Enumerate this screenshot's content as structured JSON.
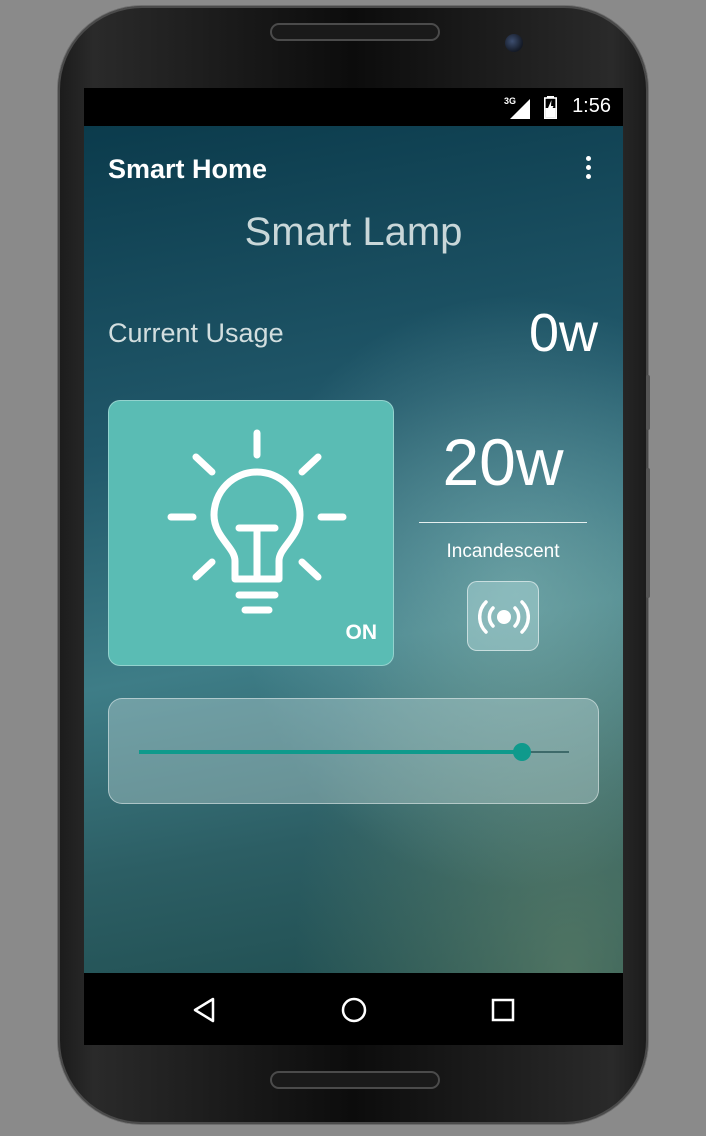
{
  "status_bar": {
    "network": "3G",
    "time": "1:56",
    "icons": [
      "signal-icon",
      "battery-icon"
    ]
  },
  "app_bar": {
    "title": "Smart Home",
    "menu_icon": "more-vert-icon"
  },
  "device": {
    "title": "Smart Lamp",
    "usage_label": "Current Usage",
    "usage_value": "0w",
    "lamp_state": "ON",
    "bulb_icon": "lightbulb-icon",
    "rated_power": "20w",
    "bulb_type": "Incandescent",
    "signal_icon": "wireless-broadcast-icon",
    "brightness_level": 0.89
  },
  "colors": {
    "accent": "#0f9a8c",
    "card": "#5abcb4"
  },
  "nav_bar": {
    "icons": [
      "back-icon",
      "home-icon",
      "recents-icon"
    ]
  }
}
